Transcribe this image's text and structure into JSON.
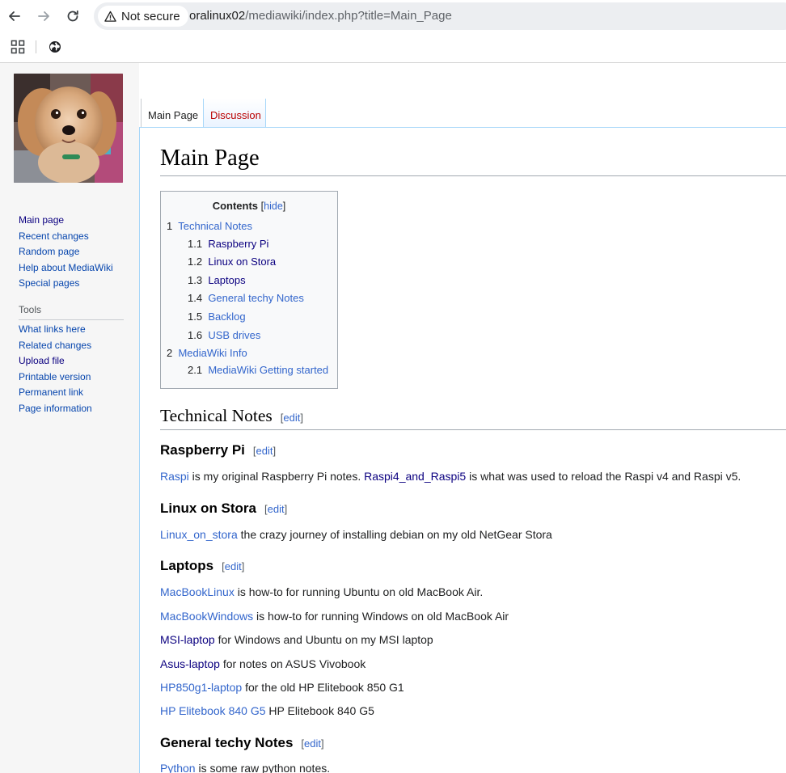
{
  "browser": {
    "security_label": "Not secure",
    "url_host": "oralinux02",
    "url_path": "/mediawiki/index.php?title=Main_Page"
  },
  "sidebar": {
    "nav": [
      {
        "label": "Main page"
      },
      {
        "label": "Recent changes"
      },
      {
        "label": "Random page"
      },
      {
        "label": "Help about MediaWiki"
      },
      {
        "label": "Special pages"
      }
    ],
    "tools_heading": "Tools",
    "tools": [
      {
        "label": "What links here"
      },
      {
        "label": "Related changes"
      },
      {
        "label": "Upload file"
      },
      {
        "label": "Printable version"
      },
      {
        "label": "Permanent link"
      },
      {
        "label": "Page information"
      }
    ]
  },
  "tabs": {
    "main": "Main Page",
    "discussion": "Discussion"
  },
  "page": {
    "title": "Main Page"
  },
  "toc": {
    "title": "Contents",
    "hide_open": "[",
    "hide": "hide",
    "hide_close": "]",
    "items": [
      {
        "num": "1",
        "label": "Technical Notes"
      },
      {
        "num": "1.1",
        "label": "Raspberry Pi"
      },
      {
        "num": "1.2",
        "label": "Linux on Stora"
      },
      {
        "num": "1.3",
        "label": "Laptops"
      },
      {
        "num": "1.4",
        "label": "General techy Notes"
      },
      {
        "num": "1.5",
        "label": "Backlog"
      },
      {
        "num": "1.6",
        "label": "USB drives"
      },
      {
        "num": "2",
        "label": "MediaWiki Info"
      },
      {
        "num": "2.1",
        "label": "MediaWiki Getting started"
      }
    ]
  },
  "edit": {
    "open": "[",
    "label": "edit",
    "close": "]"
  },
  "sections": {
    "technical_notes": "Technical Notes",
    "raspberry_pi": {
      "heading": "Raspberry Pi",
      "link1": "Raspi",
      "text1": " is my original Raspberry Pi notes. ",
      "link2": "Raspi4_and_Raspi5",
      "text2": " is what was used to reload the Raspi v4 and Raspi v5."
    },
    "linux_on_stora": {
      "heading": "Linux on Stora",
      "link": "Linux_on_stora",
      "text": " the crazy journey of installing debian on my old NetGear Stora"
    },
    "laptops": {
      "heading": "Laptops",
      "items": [
        {
          "link": "MacBookLinux",
          "text": " is how-to for running Ubuntu on old MacBook Air."
        },
        {
          "link": "MacBookWindows",
          "text": " is how-to for running Windows on old MacBook Air"
        },
        {
          "link": "MSI-laptop",
          "text": " for Windows and Ubuntu on my MSI laptop"
        },
        {
          "link": "Asus-laptop",
          "text": " for notes on ASUS Vivobook"
        },
        {
          "link": "HP850g1-laptop",
          "text": " for the old HP Elitebook 850 G1"
        },
        {
          "link": "HP Elitebook 840 G5",
          "text": " HP Elitebook 840 G5"
        }
      ]
    },
    "general_techy": {
      "heading": "General techy Notes",
      "link": "Python",
      "text": " is some raw python notes."
    }
  },
  "colors": {
    "link": "#3366cc",
    "visited_link": "#0b0080",
    "new_link": "#ba0000",
    "tab_border": "#a7d7f9"
  }
}
